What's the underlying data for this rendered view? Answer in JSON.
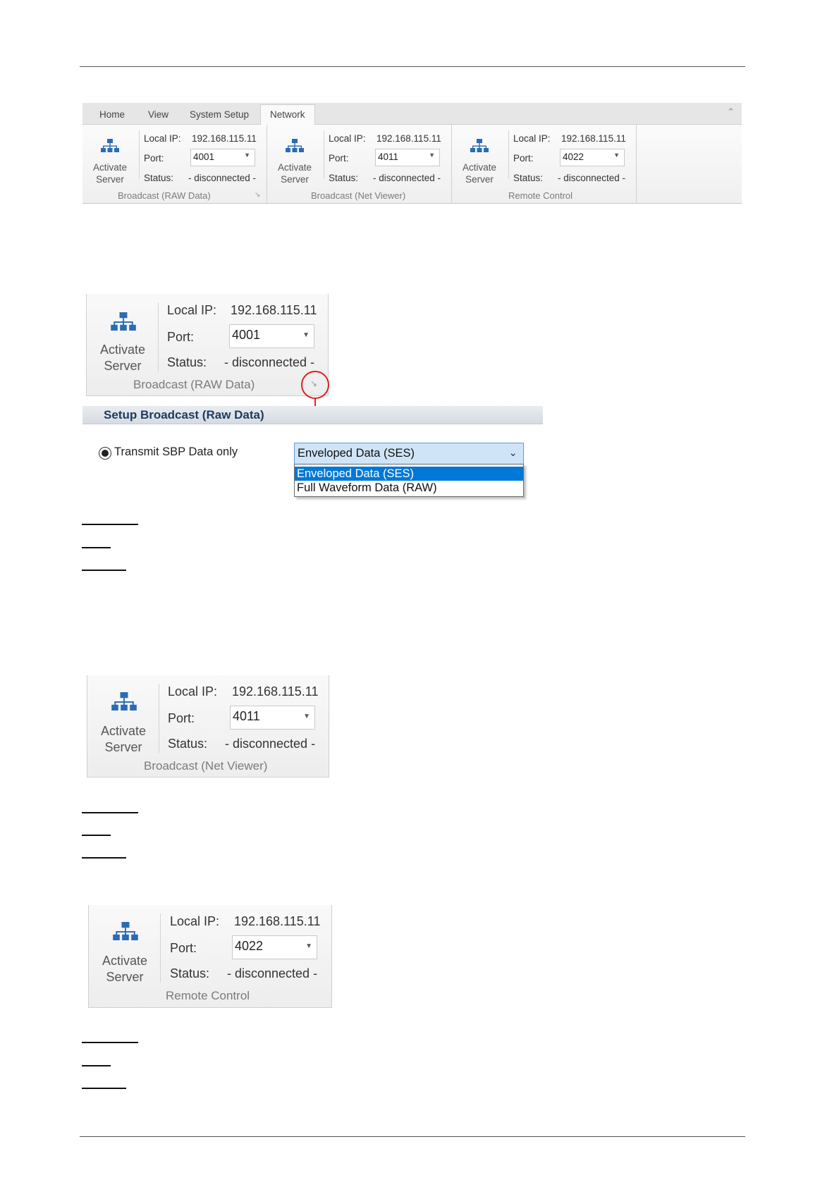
{
  "ribbon": {
    "tabs": [
      "Home",
      "View",
      "System Setup",
      "Network"
    ],
    "active_tab": "Network",
    "collapse_icon": "chevron-up-icon"
  },
  "groups": {
    "raw": {
      "activate_line1": "Activate",
      "activate_line2": "Server",
      "local_ip_label": "Local IP:",
      "local_ip": "192.168.115.11",
      "port_label": "Port:",
      "port": "4001",
      "status_label": "Status:",
      "status": "- disconnected -",
      "name": "Broadcast (RAW Data)"
    },
    "net": {
      "activate_line1": "Activate",
      "activate_line2": "Server",
      "local_ip_label": "Local IP:",
      "local_ip": "192.168.115.11",
      "port_label": "Port:",
      "port": "4011",
      "status_label": "Status:",
      "status": "- disconnected -",
      "name": "Broadcast (Net Viewer)"
    },
    "remote": {
      "activate_line1": "Activate",
      "activate_line2": "Server",
      "local_ip_label": "Local IP:",
      "local_ip": "192.168.115.11",
      "port_label": "Port:",
      "port": "4022",
      "status_label": "Status:",
      "status": "- disconnected -",
      "name": "Remote Control"
    }
  },
  "setup": {
    "title": "Setup Broadcast (Raw Data)",
    "radio_label": "Transmit SBP Data only",
    "dropdown_value": "Enveloped Data (SES)",
    "options": [
      "Enveloped Data (SES)",
      "Full Waveform Data (RAW)"
    ]
  },
  "colors": {
    "annotation_red": "#e02020",
    "selection_blue": "#0078d7",
    "icon_blue": "#2a6cb3"
  }
}
